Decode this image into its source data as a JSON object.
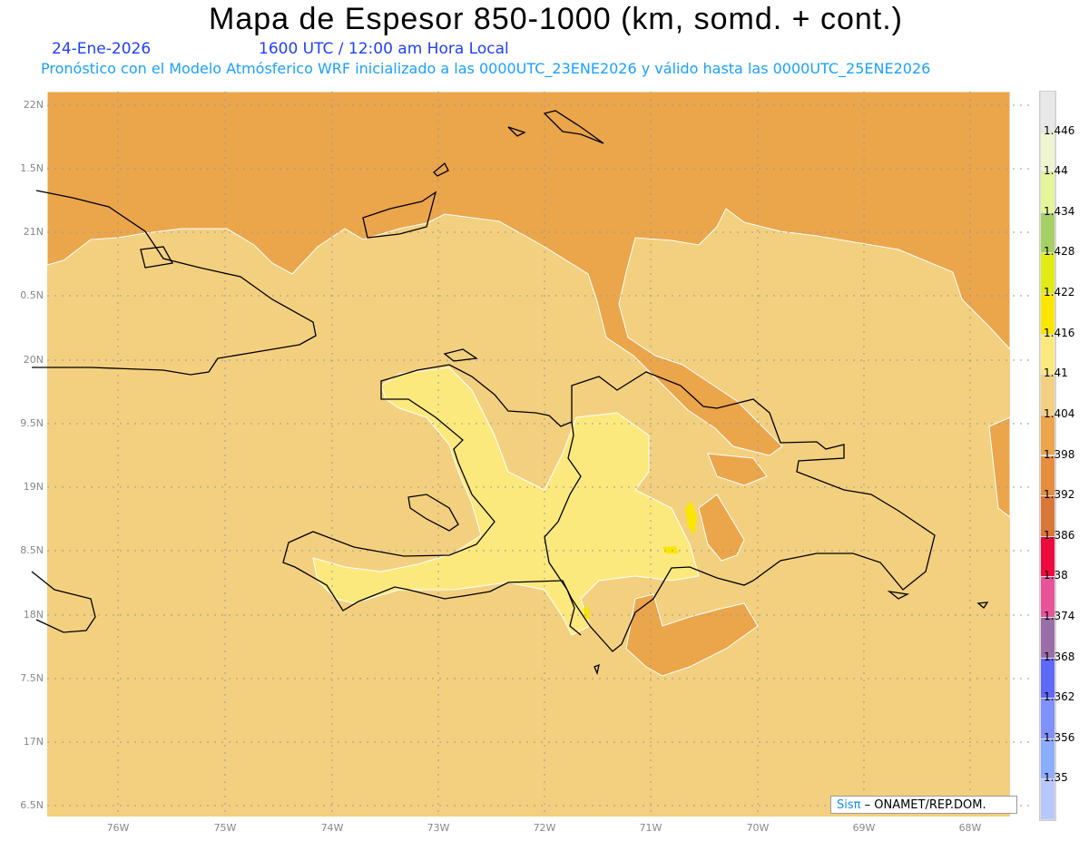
{
  "header": {
    "title": "Mapa de Espesor 850-1000 (km, somd. + cont.)",
    "date": "24-Ene-2026",
    "time": "1600 UTC / 12:00 am Hora Local",
    "subtitle": "Pronóstico con el Modelo Atmósferico WRF inicializado a las 0000UTC_23ENE2026 y válido hasta las  0000UTC_25ENE2026"
  },
  "map": {
    "lat_labels": [
      "22N",
      "1.5N",
      "21N",
      "0.5N",
      "20N",
      "9.5N",
      "19N",
      "8.5N",
      "18N",
      "7.5N",
      "17N",
      "6.5N"
    ],
    "lon_labels": [
      "76W",
      "75W",
      "74W",
      "73W",
      "72W",
      "71W",
      "70W",
      "69W",
      "68W"
    ],
    "colors": {
      "background_field": "#f3d07f",
      "dark_field": "#eba54a",
      "light_field": "#fce97e",
      "peak_field": "#fae600",
      "coast": "#000000"
    }
  },
  "colorbar": {
    "labels": [
      "1.446",
      "1.44",
      "1.434",
      "1.428",
      "1.422",
      "1.416",
      "1.41",
      "1.404",
      "1.398",
      "1.392",
      "1.386",
      "1.38",
      "1.374",
      "1.368",
      "1.362",
      "1.356",
      "1.35"
    ],
    "colors": [
      "#e8e8e8",
      "#eef5d0",
      "#e5f59a",
      "#a6cf64",
      "#e0ec14",
      "#fae600",
      "#fce97e",
      "#f3d07f",
      "#eba54a",
      "#e68e3e",
      "#d97836",
      "#ee0a3e",
      "#e8549b",
      "#9a6ea6",
      "#6068f6",
      "#8090fc",
      "#8cacfc",
      "#b8c8fc"
    ]
  },
  "credit": {
    "logo": "Sisπ",
    "text": "– ONAMET/REP.DOM."
  }
}
